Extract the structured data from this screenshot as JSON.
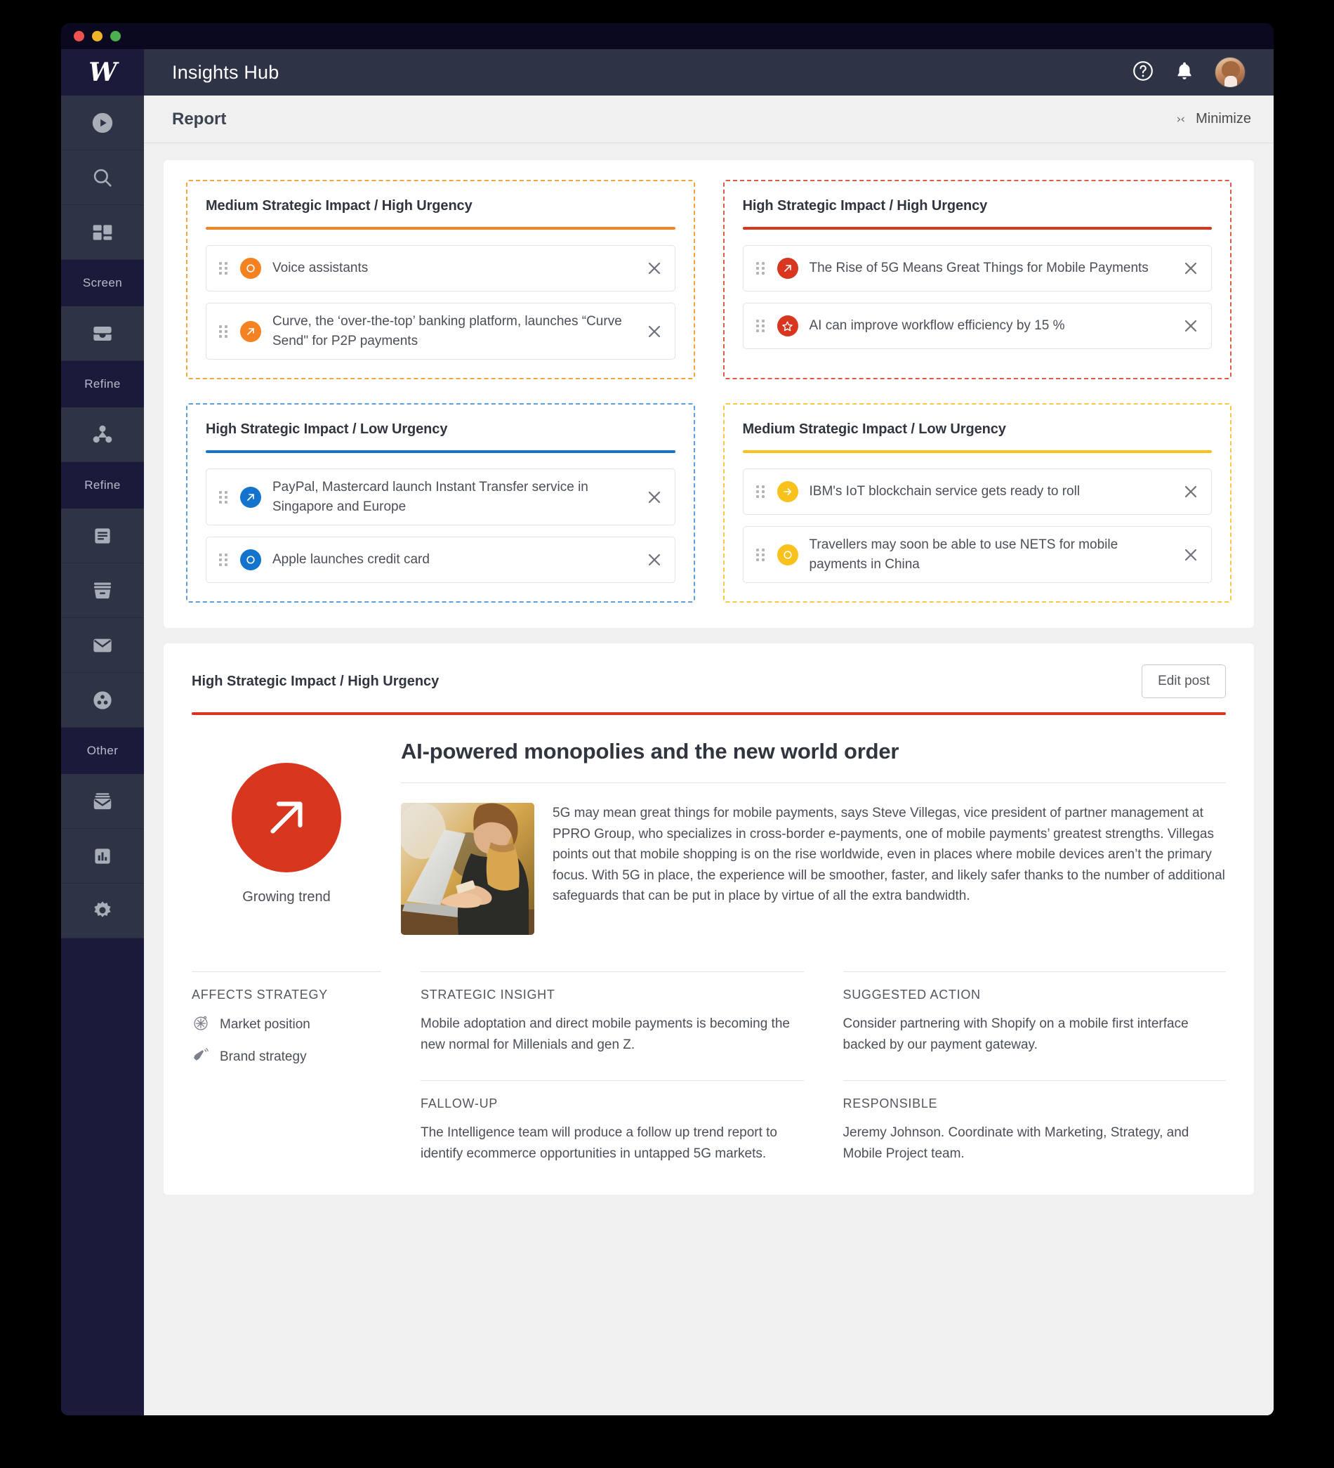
{
  "window": {
    "traffic_lights": [
      "close",
      "minimize",
      "maximize"
    ]
  },
  "brand": {
    "logo_glyph": "W"
  },
  "topbar": {
    "app_title": "Insights Hub",
    "help_icon": "help-circle-icon",
    "notifications_icon": "bell-icon",
    "avatar": "user-avatar"
  },
  "subbar": {
    "title": "Report",
    "minimize_label": "Minimize",
    "minimize_arrows": "›‹"
  },
  "sidebar": {
    "items": [
      {
        "icon": "play-circle-icon",
        "type": "icon"
      },
      {
        "icon": "search-icon",
        "type": "icon"
      },
      {
        "icon": "dashboard-grid-icon",
        "type": "icon"
      },
      {
        "label": "Screen",
        "type": "section"
      },
      {
        "icon": "inbox-icon",
        "type": "icon"
      },
      {
        "label": "Refine",
        "type": "section"
      },
      {
        "icon": "share-nodes-icon",
        "type": "icon"
      },
      {
        "label": "Refine",
        "type": "section"
      },
      {
        "icon": "document-icon",
        "type": "icon"
      },
      {
        "icon": "archive-box-icon",
        "type": "icon"
      },
      {
        "icon": "envelope-icon",
        "type": "icon"
      },
      {
        "icon": "group-circle-icon",
        "type": "icon"
      },
      {
        "label": "Other",
        "type": "section"
      },
      {
        "icon": "mail-stack-icon",
        "type": "icon"
      },
      {
        "icon": "bar-chart-icon",
        "type": "icon"
      },
      {
        "icon": "gear-icon",
        "type": "icon"
      }
    ]
  },
  "colors": {
    "orange": "#F58220",
    "red": "#D8361F",
    "blue": "#1473CC",
    "yellow": "#F9C11B"
  },
  "quadrants": [
    {
      "title": "Medium Strategic Impact / High Urgency",
      "accent": "#F58220",
      "border": "#F3A63F",
      "items": [
        {
          "icon": "circle-outline-icon",
          "text": "Voice assistants"
        },
        {
          "icon": "arrow-up-right-icon",
          "text": "Curve, the ‘over-the-top’ banking platform, launches “Curve Send\" for P2P payments"
        }
      ]
    },
    {
      "title": "High Strategic Impact / High Urgency",
      "accent": "#D8361F",
      "border": "#E05A44",
      "items": [
        {
          "icon": "arrow-up-right-icon",
          "text": "The Rise of 5G Means Great Things for Mobile Payments"
        },
        {
          "icon": "star-outline-icon",
          "text": "AI can improve workflow efficiency by 15 %"
        }
      ]
    },
    {
      "title": "High Strategic Impact / Low Urgency",
      "accent": "#1473CC",
      "border": "#5E9EDC",
      "items": [
        {
          "icon": "arrow-up-right-icon",
          "text": "PayPal, Mastercard launch Instant Transfer service in Singapore and Europe"
        },
        {
          "icon": "circle-outline-icon",
          "text": "Apple launches credit card"
        }
      ]
    },
    {
      "title": "Medium Strategic Impact / Low Urgency",
      "accent": "#F9C11B",
      "border": "#F7C844",
      "items": [
        {
          "icon": "arrow-right-icon",
          "text": "IBM's IoT blockchain service gets ready to roll"
        },
        {
          "icon": "circle-outline-icon",
          "text": "Travellers may soon be able to use NETS for mobile payments in China"
        }
      ]
    }
  ],
  "remove_icon": "close-x-icon",
  "drag_handle_icon": "drag-grip-icon",
  "detail": {
    "kicker": "High Strategic Impact / High Urgency",
    "edit_button": "Edit post",
    "accent": "#D8361F",
    "trend_icon": "arrow-up-right-icon",
    "trend_label": "Growing trend",
    "article_title": "AI-powered monopolies and the new world order",
    "thumbnail_alt": "woman-using-laptop-photo",
    "paragraph": "5G may mean great things for mobile payments, says Steve Villegas, vice president  of partner management at PPRO Group, who specializes in cross-border e-payments, one of mobile payments’ greatest strengths. Villegas points out that mobile shopping is on the rise worldwide, even in places where mobile devices  aren’t the primary focus. With 5G in place, the experience will be smoother, faster, and likely safer thanks to  the number of additional safeguards that can be put in place by virtue of all the extra bandwidth.",
    "affects_strategy": {
      "heading": "Affects strategy",
      "tags": [
        {
          "icon": "compass-icon",
          "label": "Market position"
        },
        {
          "icon": "megaphone-icon",
          "label": "Brand strategy"
        }
      ]
    },
    "strategic_insight": {
      "heading": "Strategic insight",
      "body": "Mobile adoptation and direct mobile payments is becoming the new normal for Millenials and gen Z."
    },
    "suggested_action": {
      "heading": "Suggested action",
      "body": "Consider partnering with Shopify on a mobile first interface backed by our payment gateway."
    },
    "follow_up": {
      "heading": "Fallow-up",
      "body": "The Intelligence team will produce a follow up trend report to identify ecommerce opportunities in untapped 5G markets."
    },
    "responsible": {
      "heading": "Responsible",
      "body": "Jeremy Johnson. Coordinate with Marketing, Strategy, and Mobile Project team."
    }
  }
}
